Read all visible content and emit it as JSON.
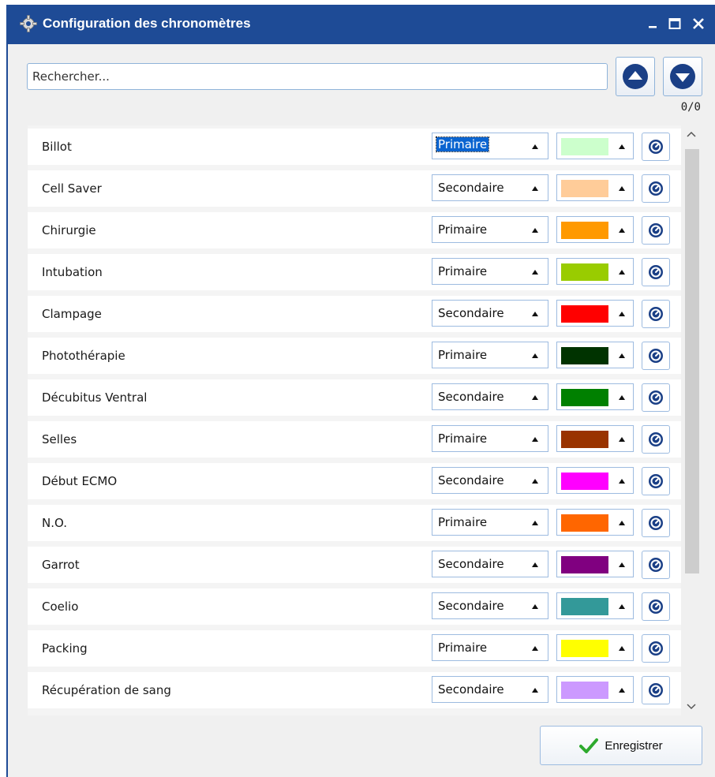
{
  "window": {
    "title": "Configuration des chronomètres",
    "minimize_icon": "minimize-icon",
    "maximize_icon": "maximize-icon",
    "close_icon": "close-icon"
  },
  "search": {
    "placeholder": "Rechercher...",
    "value": "",
    "counter": "0/0"
  },
  "timers": [
    {
      "label": "Billot",
      "type": "Primaire",
      "color": "#ccffcc",
      "selected": true
    },
    {
      "label": "Cell Saver",
      "type": "Secondaire",
      "color": "#ffcc99"
    },
    {
      "label": "Chirurgie",
      "type": "Primaire",
      "color": "#ff9900"
    },
    {
      "label": "Intubation",
      "type": "Primaire",
      "color": "#99cc00"
    },
    {
      "label": "Clampage",
      "type": "Secondaire",
      "color": "#ff0000"
    },
    {
      "label": "Photothérapie",
      "type": "Primaire",
      "color": "#003300"
    },
    {
      "label": "Décubitus Ventral",
      "type": "Secondaire",
      "color": "#008000"
    },
    {
      "label": "Selles",
      "type": "Primaire",
      "color": "#993300"
    },
    {
      "label": "Début ECMO",
      "type": "Secondaire",
      "color": "#ff00ff"
    },
    {
      "label": "N.O.",
      "type": "Primaire",
      "color": "#ff6600"
    },
    {
      "label": "Garrot",
      "type": "Secondaire",
      "color": "#800080"
    },
    {
      "label": "Coelio",
      "type": "Secondaire",
      "color": "#339999"
    },
    {
      "label": "Packing",
      "type": "Primaire",
      "color": "#ffff00"
    },
    {
      "label": "Récupération de sang",
      "type": "Secondaire",
      "color": "#cc99ff"
    }
  ],
  "footer": {
    "save_label": "Enregistrer",
    "save_icon": "checkmark-icon"
  },
  "colors": {
    "titlebar": "#1e4b96",
    "accent": "#1e4b96",
    "border": "#9dbbe0"
  }
}
